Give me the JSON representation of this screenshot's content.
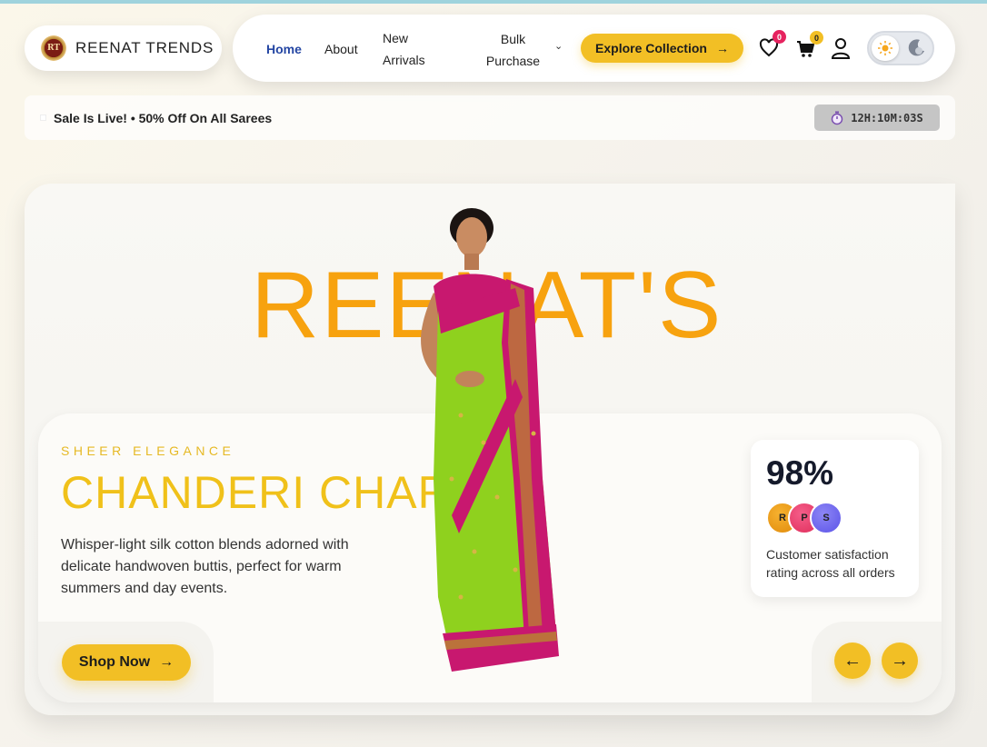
{
  "brand": {
    "name": "REENAT TRENDS",
    "logo_initials": "RT"
  },
  "nav": {
    "links": [
      "Home",
      "About",
      "New Arrivals",
      "Bulk Purchase"
    ],
    "active": "Home",
    "cta_label": "Explore Collection",
    "wishlist_count": "0",
    "cart_count": "0",
    "theme": "light"
  },
  "sale": {
    "text": "Sale Is Live! • 50% Off On All Sarees",
    "timer": "12H:10M:03S"
  },
  "hero": {
    "title": "REENAT'S",
    "subtitle_label": "SHEER ELEGANCE",
    "product_title": "CHANDERI CHARM",
    "description": "Whisper-light silk cotton blends adorned with delicate handwoven buttis, perfect for warm summers and day events.",
    "shop_label": "Shop Now",
    "stat": {
      "value": "98%",
      "avatars": [
        "R",
        "P",
        "S"
      ],
      "description": "Customer satisfaction rating across all orders"
    }
  },
  "colors": {
    "accent": "#f2bf25",
    "title_orange": "#f7a20f",
    "nav_active": "#2446a3",
    "saree_green": "#8fd11e",
    "saree_pink": "#c8186f"
  }
}
